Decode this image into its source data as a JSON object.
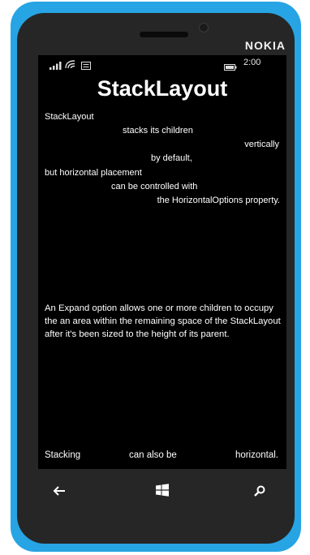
{
  "device": {
    "brand": "NOKIA"
  },
  "status_bar": {
    "time": "2:00",
    "icons": [
      "signal-icon",
      "wifi-icon",
      "message-icon",
      "battery-icon"
    ]
  },
  "page": {
    "title": "StackLayout",
    "lines": [
      "StackLayout",
      "stacks its children",
      "vertically",
      "by default,",
      "but horizontal placement",
      "can be controlled with",
      "the HorizontalOptions property."
    ],
    "expand_paragraph": "An Expand option allows one or more children to occupy the an area within the remaining space of the StackLayout after it's been sized to the height of its parent.",
    "horizontal_items": [
      "Stacking",
      "can also be",
      "horizontal."
    ]
  },
  "nav_bar": {
    "buttons": [
      "back-icon",
      "windows-start-icon",
      "search-icon"
    ]
  },
  "colors": {
    "phone_body": "#27a4e3",
    "bezel": "#262626",
    "screen_background": "#000000",
    "text": "#ffffff"
  }
}
